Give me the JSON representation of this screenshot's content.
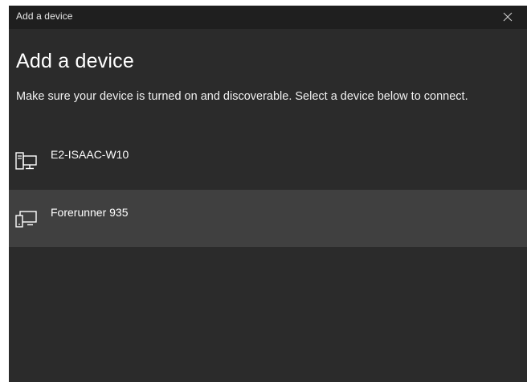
{
  "window": {
    "title": "Add a device",
    "close_icon": "close-icon"
  },
  "page": {
    "heading": "Add a device",
    "instructions": "Make sure your device is turned on and discoverable. Select a device below to connect."
  },
  "devices": [
    {
      "label": "E2-ISAAC-W10",
      "icon": "desktop-computer-icon",
      "selected": false
    },
    {
      "label": "Forerunner 935",
      "icon": "generic-device-icon",
      "selected": true
    }
  ],
  "colors": {
    "window_bg": "#2b2b2b",
    "titlebar_bg": "#1f1f1f",
    "selected_row_bg": "#404040",
    "text": "#ffffff"
  }
}
